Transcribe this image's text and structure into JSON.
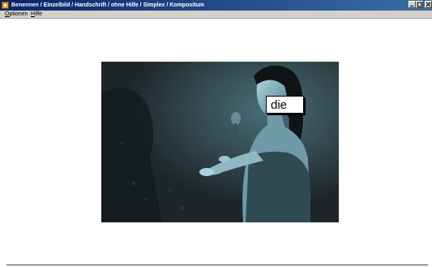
{
  "window": {
    "title": "Benennen / Einzelbild / Handschrift / ohne Hilfe / Simplex / Kompositum",
    "buttons": [
      "minimize",
      "maximize",
      "close"
    ]
  },
  "menu": {
    "optionen_underlined": "O",
    "optionen_rest": "ptionen",
    "hilfe_underlined": "H",
    "hilfe_rest": "ilfe"
  },
  "content": {
    "image_description_icon": "singer-photo",
    "word_label": "die"
  },
  "colors": {
    "titlebar_start": "#0a246a",
    "titlebar_end": "#3a6ea5",
    "photo_background": "#1e2629"
  }
}
